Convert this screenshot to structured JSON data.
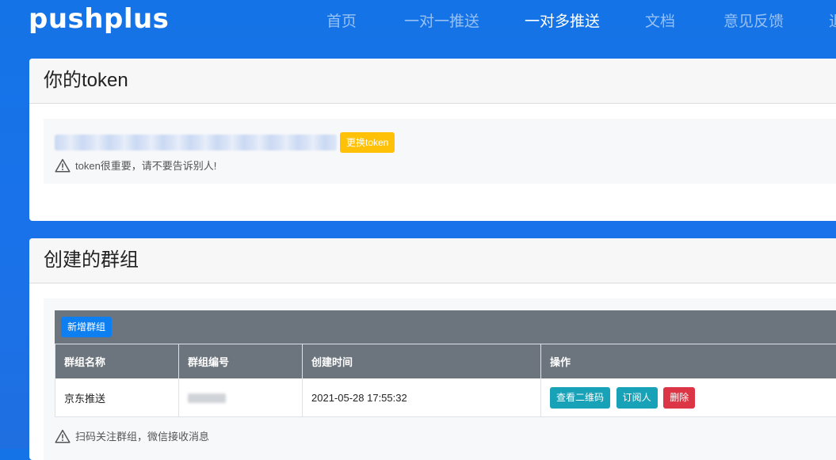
{
  "nav": {
    "logo": "pushplus",
    "links": [
      {
        "label": "首页"
      },
      {
        "label": "一对一推送"
      },
      {
        "label": "一对多推送",
        "active": true
      },
      {
        "label": "文档"
      },
      {
        "label": "意见反馈"
      },
      {
        "label": "退"
      }
    ]
  },
  "token_card": {
    "title": "你的token",
    "token_value": "",
    "change_button": "更换token",
    "warning": "token很重要，请不要告诉别人!"
  },
  "group_card": {
    "title": "创建的群组",
    "add_button": "新增群组",
    "columns": [
      "群组名称",
      "群组编号",
      "创建时间",
      "操作"
    ],
    "rows": [
      {
        "name": "京东推送",
        "code": "",
        "created": "2021-05-28 17:55:32",
        "actions": [
          "查看二维码",
          "订阅人",
          "删除"
        ]
      }
    ],
    "hint": "扫码关注群组，微信接收消息"
  },
  "colors": {
    "background": "#1a72ea",
    "warning_button": "#ffc107",
    "primary_button": "#0d7ff0",
    "info_button": "#17a2b8",
    "danger_button": "#dc3545",
    "table_header": "#6c757d"
  }
}
